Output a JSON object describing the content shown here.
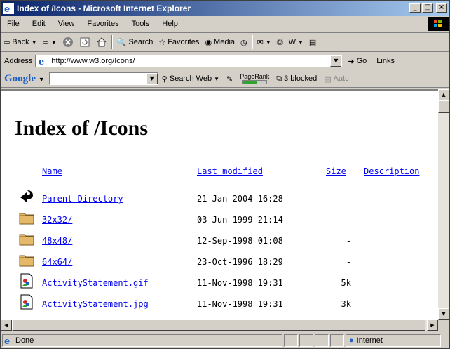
{
  "window": {
    "title": "Index of /Icons - Microsoft Internet Explorer",
    "controls": [
      "_",
      "□",
      "×"
    ]
  },
  "menu": [
    "File",
    "Edit",
    "View",
    "Favorites",
    "Tools",
    "Help"
  ],
  "toolbar": {
    "back": "Back",
    "search": "Search",
    "favorites": "Favorites",
    "media": "Media"
  },
  "address": {
    "label": "Address",
    "url": "http://www.w3.org/Icons/",
    "go": "Go",
    "links": "Links"
  },
  "google": {
    "logo": "Google",
    "search_web": "Search Web",
    "pagerank": "PageRank",
    "pagerank_level": 0.6,
    "blocked": "3 blocked",
    "autofill": "Autc"
  },
  "page": {
    "heading": "Index of /Icons",
    "columns": {
      "name": "Name",
      "last_modified": "Last modified",
      "size": "Size",
      "description": "Description"
    },
    "rows": [
      {
        "icon": "back-arrow-icon",
        "name": "Parent Directory",
        "modified": "21-Jan-2004 16:28",
        "size": "-"
      },
      {
        "icon": "folder-icon",
        "name": "32x32/",
        "modified": "03-Jun-1999 21:14",
        "size": "-"
      },
      {
        "icon": "folder-icon",
        "name": "48x48/",
        "modified": "12-Sep-1998 01:08",
        "size": "-"
      },
      {
        "icon": "folder-icon",
        "name": "64x64/",
        "modified": "23-Oct-1996 18:29",
        "size": "-"
      },
      {
        "icon": "image-file-icon",
        "name": "ActivityStatement.gif",
        "modified": "11-Nov-1998 19:31",
        "size": "5k"
      },
      {
        "icon": "image-file-icon",
        "name": "ActivityStatement.jpg",
        "modified": "11-Nov-1998 19:31",
        "size": "3k"
      }
    ]
  },
  "status": {
    "text": "Done",
    "zone": "Internet"
  },
  "colors": {
    "titlebar_start": "#0a246a",
    "titlebar_end": "#a6caf0",
    "chrome": "#d4d0c8",
    "link": "#0000ee"
  }
}
